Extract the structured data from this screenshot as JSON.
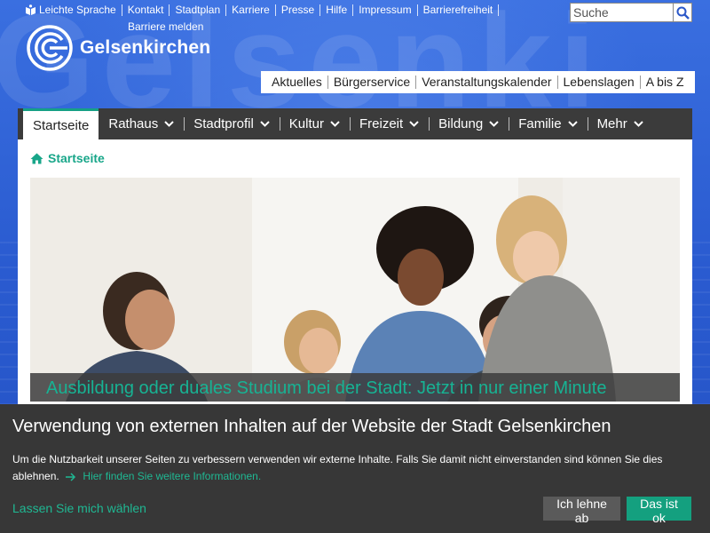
{
  "toplinks": [
    "Leichte Sprache",
    "Kontakt",
    "Stadtplan",
    "Karriere",
    "Presse",
    "Hilfe",
    "Impressum",
    "Barrierefreiheit"
  ],
  "barriere_label": "Barriere melden",
  "search": {
    "placeholder": "Suche"
  },
  "logo_text": "Gelsenkirchen",
  "secondary_nav": [
    "Aktuelles",
    "Bürgerservice",
    "Veranstaltungskalender",
    "Lebenslagen",
    "A bis Z"
  ],
  "main_nav": [
    {
      "label": "Startseite",
      "active": true,
      "dropdown": false
    },
    {
      "label": "Rathaus",
      "active": false,
      "dropdown": true
    },
    {
      "label": "Stadtprofil",
      "active": false,
      "dropdown": true
    },
    {
      "label": "Kultur",
      "active": false,
      "dropdown": true
    },
    {
      "label": "Freizeit",
      "active": false,
      "dropdown": true
    },
    {
      "label": "Bildung",
      "active": false,
      "dropdown": true
    },
    {
      "label": "Familie",
      "active": false,
      "dropdown": true
    },
    {
      "label": "Mehr",
      "active": false,
      "dropdown": true
    }
  ],
  "breadcrumb": "Startseite",
  "hero_caption": "Ausbildung oder duales Studium bei der Stadt: Jetzt in nur einer Minute",
  "cookie": {
    "title": "Verwendung von externen Inhalten auf der Website der Stadt Gelsenkirchen",
    "text": "Um die Nutzbarkeit unserer Seiten zu verbessern verwenden wir externe Inhalte. Falls Sie damit nicht einverstanden sind können Sie dies ablehnen.",
    "more_link": "Hier finden Sie weitere Informationen.",
    "choose_link": "Lassen Sie mich wählen",
    "reject_label": "Ich lehne ab",
    "accept_label": "Das ist ok"
  },
  "colors": {
    "brand_blue": "#2f63d6",
    "accent_green": "#16a085",
    "nav_dark": "#3b3b3b",
    "banner_dark": "#373737"
  }
}
